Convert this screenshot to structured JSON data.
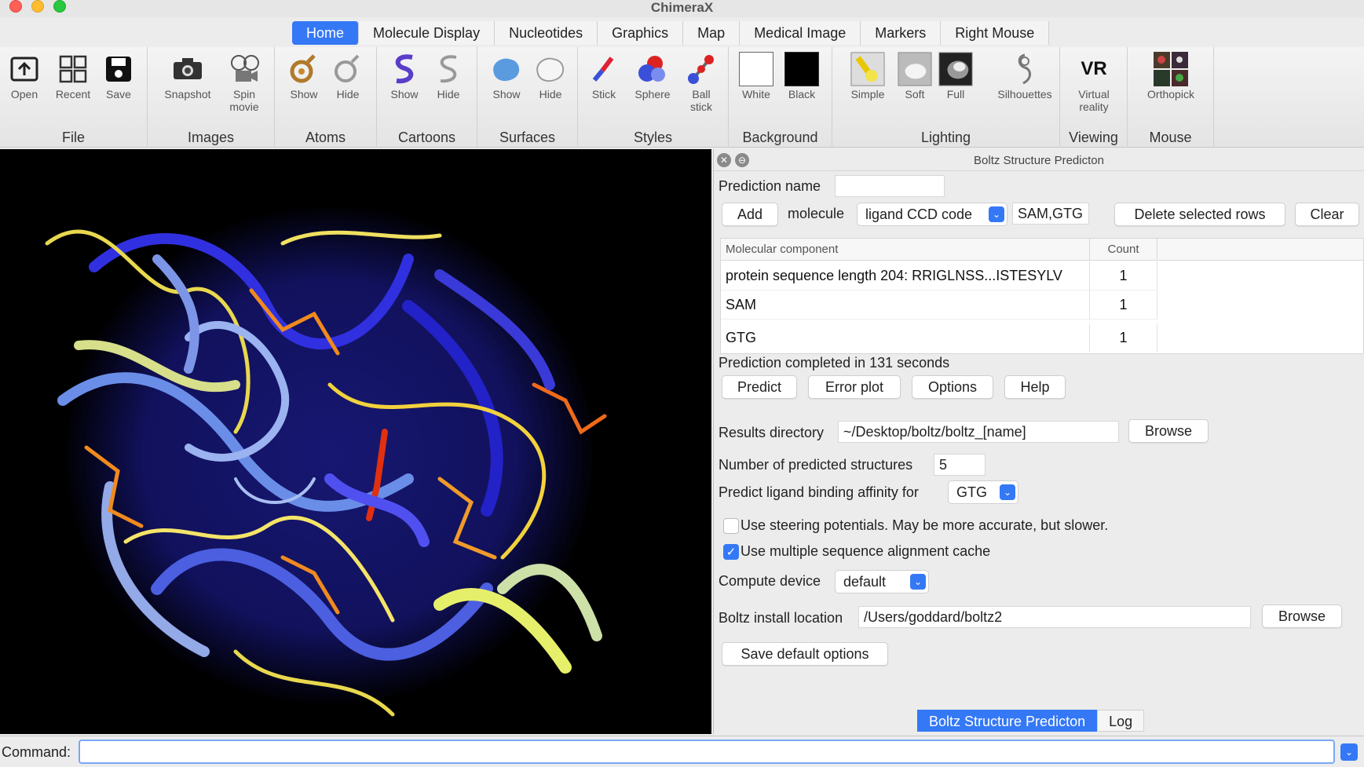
{
  "app": {
    "title": "ChimeraX"
  },
  "tabs": [
    {
      "label": "Home"
    },
    {
      "label": "Molecule Display"
    },
    {
      "label": "Nucleotides"
    },
    {
      "label": "Graphics"
    },
    {
      "label": "Map"
    },
    {
      "label": "Medical Image"
    },
    {
      "label": "Markers"
    },
    {
      "label": "Right Mouse"
    }
  ],
  "toolbar": {
    "file": {
      "label": "File",
      "open": "Open",
      "recent": "Recent",
      "save": "Save"
    },
    "images": {
      "label": "Images",
      "snapshot": "Snapshot",
      "spin1": "Spin",
      "spin2": "movie"
    },
    "atoms": {
      "label": "Atoms",
      "show": "Show",
      "hide": "Hide"
    },
    "cartoons": {
      "label": "Cartoons",
      "show": "Show",
      "hide": "Hide"
    },
    "surfaces": {
      "label": "Surfaces",
      "show": "Show",
      "hide": "Hide"
    },
    "styles": {
      "label": "Styles",
      "stick": "Stick",
      "sphere": "Sphere",
      "ball1": "Ball",
      "ball2": "stick"
    },
    "background": {
      "label": "Background",
      "white": "White",
      "black": "Black"
    },
    "lighting": {
      "label": "Lighting",
      "simple": "Simple",
      "soft": "Soft",
      "full": "Full",
      "silhouettes": "Silhouettes"
    },
    "viewing": {
      "label": "Viewing",
      "vr_icon": "VR",
      "vr1": "Virtual",
      "vr2": "reality"
    },
    "mouse": {
      "label": "Mouse",
      "orthopick": "Orthopick"
    }
  },
  "panel": {
    "title": "Boltz Structure Predicton",
    "prediction_name_label": "Prediction name",
    "prediction_name_value": "",
    "add_button": "Add",
    "molecule_label": "molecule",
    "molecule_type": "ligand CCD code",
    "molecule_value": "SAM,GTG",
    "delete_rows_button": "Delete selected rows",
    "clear_button": "Clear",
    "table": {
      "headers": [
        "Molecular component",
        "Count"
      ],
      "rows": [
        {
          "component": "protein sequence length 204: RRIGLNSS...ISTESYLV",
          "count": "1"
        },
        {
          "component": "SAM",
          "count": "1"
        },
        {
          "component": "GTG",
          "count": "1"
        }
      ]
    },
    "status": "Prediction completed in 131 seconds",
    "predict_button": "Predict",
    "error_plot_button": "Error plot",
    "options_button": "Options",
    "help_button": "Help",
    "results_dir_label": "Results directory",
    "results_dir_value": "~/Desktop/boltz/boltz_[name]",
    "browse_button": "Browse",
    "num_structures_label": "Number of predicted structures",
    "num_structures_value": "5",
    "affinity_label": "Predict ligand binding affinity for",
    "affinity_value": "GTG",
    "steering_label": "Use steering potentials.  May be more accurate, but slower.",
    "steering_checked": false,
    "msa_cache_label": "Use multiple sequence alignment cache",
    "msa_cache_checked": true,
    "compute_device_label": "Compute device",
    "compute_device_value": "default",
    "install_location_label": "Boltz install location",
    "install_location_value": "/Users/goddard/boltz2",
    "browse2_button": "Browse",
    "save_defaults_button": "Save default options",
    "bottom_tabs": [
      "Boltz Structure Predicton",
      "Log"
    ]
  },
  "command": {
    "label": "Command:",
    "value": ""
  }
}
